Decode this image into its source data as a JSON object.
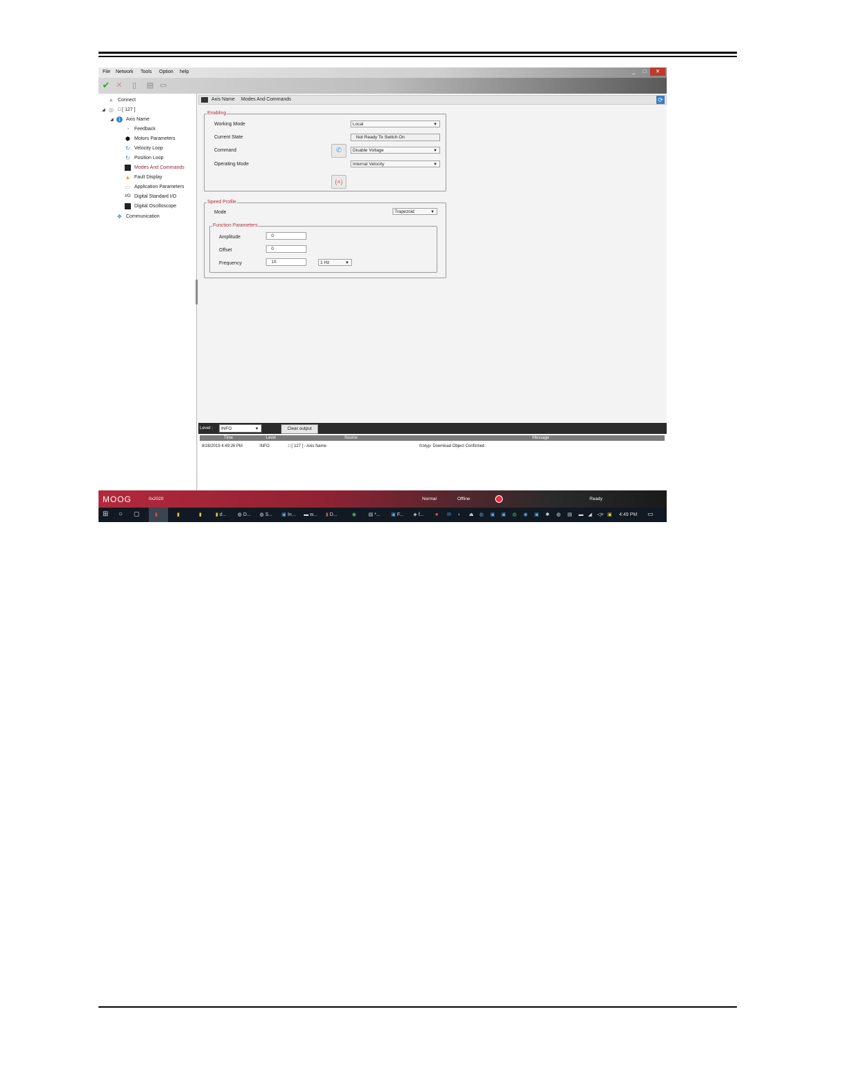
{
  "menu": {
    "file": "File",
    "network": "Network",
    "tools": "Tools",
    "option": "Option",
    "help": "help"
  },
  "window_controls": {
    "minimize": "_",
    "maximize": "□",
    "close": "✕"
  },
  "toolbar_icons": [
    "check-icon",
    "cancel-icon",
    "trash-icon",
    "grid-icon",
    "print-icon"
  ],
  "tree": {
    "connect": "Connect",
    "node_127": "□ [ 127 ]",
    "axis_name": "Axis Name",
    "feedback": "Feedback",
    "motors_parameters": "Motors Parameters",
    "velocity_loop": "Velocity Loop",
    "position_loop": "Position Loop",
    "modes_and_commands": "Modes And Commands",
    "fault_display": "Fault Display",
    "application_parameters": "Application Parameters",
    "digital_standard_io": "Digital Standard I/O",
    "digital_oscilloscope": "Digital Oscilloscope",
    "communication": "Communication"
  },
  "header": {
    "axis_name": "Axis Name",
    "section": "Modes And Commands"
  },
  "enabling": {
    "title": "Enabling",
    "working_mode_label": "Working Mode",
    "working_mode_value": "Local",
    "current_state_label": "Current State",
    "current_state_value": "Not Ready To Switch On",
    "command_label": "Command",
    "command_value": "Disable Voltage",
    "operating_mode_label": "Operating Mode",
    "operating_mode_value": "Internal Velocity"
  },
  "speed_profile": {
    "title": "Speed Profile",
    "mode_label": "Mode",
    "mode_value": "Trapezoid"
  },
  "function_parameters": {
    "title": "Function Parameters",
    "amplitude_label": "Amplitude",
    "amplitude_value": "0",
    "offset_label": "Offset",
    "offset_value": "0",
    "frequency_label": "Frequency",
    "frequency_value": "10",
    "frequency_unit": "1 Hz"
  },
  "log": {
    "level_label": "Level :",
    "level_value": "INFO",
    "clear_button": "Clear output",
    "columns": {
      "time": "Time",
      "level": "Level",
      "source": "Source",
      "message": "Message"
    },
    "rows": [
      {
        "time": "8/28/2019 4:49:26 PM",
        "level": "INFO",
        "source": "□ [ 127 ] - Axis Name",
        "message": "fcntyp: Download Object Confirmed"
      }
    ]
  },
  "status": {
    "logo": "MOOG",
    "code": "0x2020",
    "mode": "Normal",
    "connection": "Offline",
    "state": "Ready"
  },
  "taskbar": {
    "items": [
      "d...",
      "D...",
      "S...",
      "In...",
      "w...",
      "D...",
      "*...",
      "F...",
      "f..."
    ],
    "clock": "4:49 PM"
  }
}
